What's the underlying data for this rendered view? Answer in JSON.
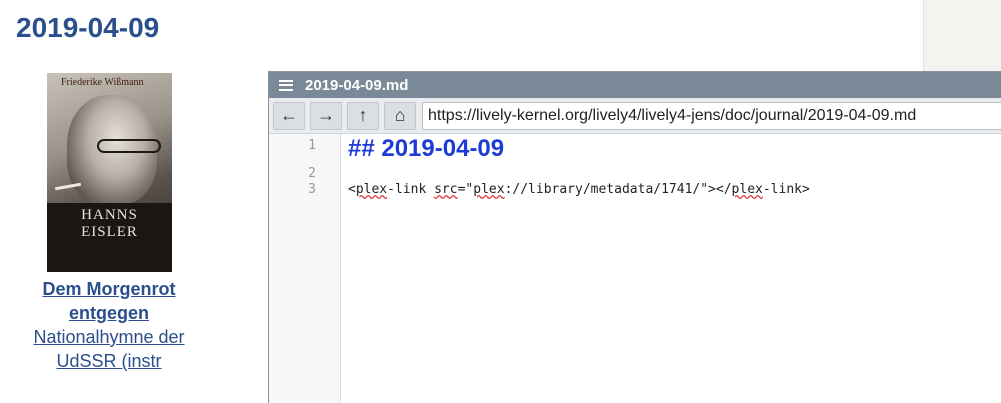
{
  "journal": {
    "title": "2019-04-09"
  },
  "book": {
    "cover_author": "Friederike Wißmann",
    "cover_name_1": "HANNS",
    "cover_name_2": "EISLER",
    "link_title": "Dem Morgenrot entgegen",
    "link_subtitle": "Nationalhymne der UdSSR (instr"
  },
  "window": {
    "title": "2019-04-09.md",
    "url": "https://lively-kernel.org/lively4/lively4-jens/doc/journal/2019-04-09.md",
    "nav": {
      "back_icon": "←",
      "forward_icon": "→",
      "up_icon": "↑",
      "home_icon": "⌂"
    }
  },
  "editor": {
    "line_numbers": [
      "1",
      "2",
      "3"
    ],
    "line1": "## 2019-04-09",
    "line3_parts": {
      "open": "<",
      "tag1": "plex",
      "tag1_rest": "-link ",
      "attr": "src",
      "eq": "=\"",
      "proto": "plex",
      "path": "://library/metadata/1741/\"></",
      "tag2": "plex",
      "close": "-link>"
    }
  }
}
